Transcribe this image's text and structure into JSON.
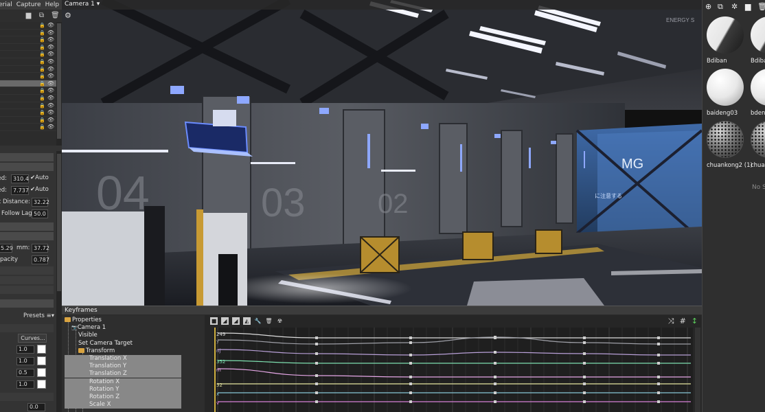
{
  "menu": [
    "erial",
    "Capture",
    "Help"
  ],
  "scene_panel": {
    "row_count": 15,
    "selected_row": 8
  },
  "camera_props": {
    "move_speed_label": "ed:",
    "move_speed": "310.4",
    "move_speed_auto": "Auto",
    "rot_speed_label": "ed:",
    "rot_speed": "7.737",
    "rot_speed_auto": "Auto",
    "pivot_label": "ot Distance:",
    "pivot_value": "32.22",
    "follow_label": "Follow Lag",
    "follow_value": "50.0",
    "fov_value": "5.29",
    "mm_label": "mm:",
    "mm_value": "37.72",
    "opacity_label": "pacity",
    "opacity_value": "0.787",
    "presets_label": "Presets",
    "curves_label": "Curves...",
    "curve_values": [
      "1.0",
      "1.0",
      "0.5",
      "1.0"
    ],
    "bottom_value": "0.0"
  },
  "viewport": {
    "camera_label": "Camera 1 ▾",
    "bay_numbers": [
      "04",
      "03",
      "02"
    ],
    "sign_logo": "MG",
    "sign_text": "に注意する",
    "top_text": "ENERGY S"
  },
  "keyframes": {
    "title": "Keyframes",
    "tree": [
      {
        "label": "Properties",
        "folder": true,
        "indent": 0
      },
      {
        "label": "Camera 1",
        "folder": false,
        "indent": 1
      },
      {
        "label": "Visible",
        "folder": false,
        "indent": 2
      },
      {
        "label": "Set Camera Target",
        "folder": false,
        "indent": 2
      },
      {
        "label": "Transform",
        "folder": true,
        "indent": 2
      },
      {
        "label": "Translation X",
        "folder": false,
        "indent": 3
      },
      {
        "label": "Translation Y",
        "folder": false,
        "indent": 3
      },
      {
        "label": "Translation Z",
        "folder": false,
        "indent": 3
      },
      {
        "label": "Rotation X",
        "folder": false,
        "indent": 3
      },
      {
        "label": "Rotation Y",
        "folder": false,
        "indent": 3
      },
      {
        "label": "Rotation Z",
        "folder": false,
        "indent": 3
      },
      {
        "label": "Scale X",
        "folder": false,
        "indent": 3
      }
    ],
    "curve_labels": [
      "249",
      "y",
      "nj",
      "352",
      "m",
      "52",
      "x",
      "v"
    ]
  },
  "materials": [
    {
      "name": "Bdiban",
      "style": "half"
    },
    {
      "name": "Bdiban",
      "style": "half"
    },
    {
      "name": "baideng03",
      "style": "white"
    },
    {
      "name": "bdeng",
      "style": "white"
    },
    {
      "name": "chuankong2 (1)",
      "style": "mesh"
    },
    {
      "name": "chuan",
      "style": "mesh"
    }
  ],
  "no_selection": "No S",
  "colors": {
    "panel": "#333333",
    "accent_blue": "#4a7fff",
    "folder": "#d9a441",
    "curve_pink": "#e7a8e8",
    "curve_green": "#7ee0b0"
  }
}
